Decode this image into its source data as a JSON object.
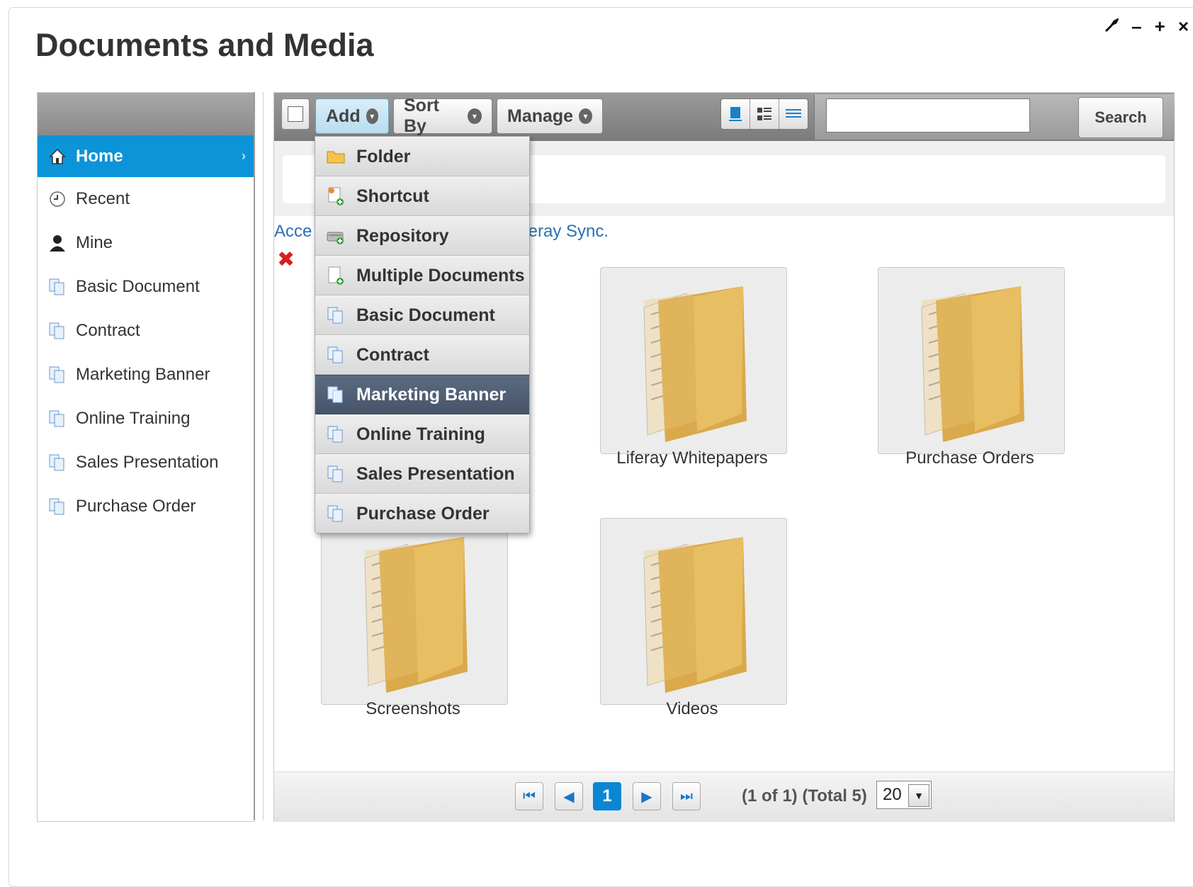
{
  "portlet": {
    "title": "Documents and Media",
    "controls": {
      "config": "🔧",
      "minimize": "–",
      "maximize": "+",
      "close": "×"
    }
  },
  "nav": {
    "items": [
      {
        "label": "Home",
        "icon": "home-icon",
        "active": true
      },
      {
        "label": "Recent",
        "icon": "clock-icon"
      },
      {
        "label": "Mine",
        "icon": "user-icon"
      },
      {
        "label": "Basic Document",
        "icon": "document-type-icon"
      },
      {
        "label": "Contract",
        "icon": "document-type-icon"
      },
      {
        "label": "Marketing Banner",
        "icon": "document-type-icon"
      },
      {
        "label": "Online Training",
        "icon": "document-type-icon"
      },
      {
        "label": "Sales Presentation",
        "icon": "document-type-icon"
      },
      {
        "label": "Purchase Order",
        "icon": "document-type-icon"
      }
    ]
  },
  "toolbar": {
    "add_label": "Add",
    "sort_label": "Sort By",
    "manage_label": "Manage",
    "views": [
      "icon-view-icon",
      "descriptive-view-icon",
      "list-view-icon"
    ],
    "search_value": "",
    "search_button": "Search"
  },
  "add_menu": {
    "items": [
      {
        "label": "Folder",
        "icon": "folder-icon"
      },
      {
        "label": "Shortcut",
        "icon": "shortcut-icon"
      },
      {
        "label": "Repository",
        "icon": "repository-icon"
      },
      {
        "label": "Multiple Documents",
        "icon": "multiple-documents-icon"
      },
      {
        "label": "Basic Document",
        "icon": "document-type-icon"
      },
      {
        "label": "Contract",
        "icon": "document-type-icon"
      },
      {
        "label": "Marketing Banner",
        "icon": "document-type-icon",
        "highlighted": true
      },
      {
        "label": "Online Training",
        "icon": "document-type-icon"
      },
      {
        "label": "Sales Presentation",
        "icon": "document-type-icon"
      },
      {
        "label": "Purchase Order",
        "icon": "document-type-icon"
      }
    ]
  },
  "sync_message": {
    "left_text": "Acce",
    "right_text": "feray Sync."
  },
  "folders": [
    {
      "name": "Liferay Whitepapers"
    },
    {
      "name": "Purchase Orders"
    },
    {
      "name": "Screenshots"
    },
    {
      "name": "Videos"
    }
  ],
  "pager": {
    "current_page": "1",
    "info": "(1 of 1) (Total 5)",
    "page_size": "20"
  },
  "colors": {
    "accent": "#0b94d8",
    "menu_highlight": "#4f5d73",
    "link": "#2a6fb5"
  }
}
